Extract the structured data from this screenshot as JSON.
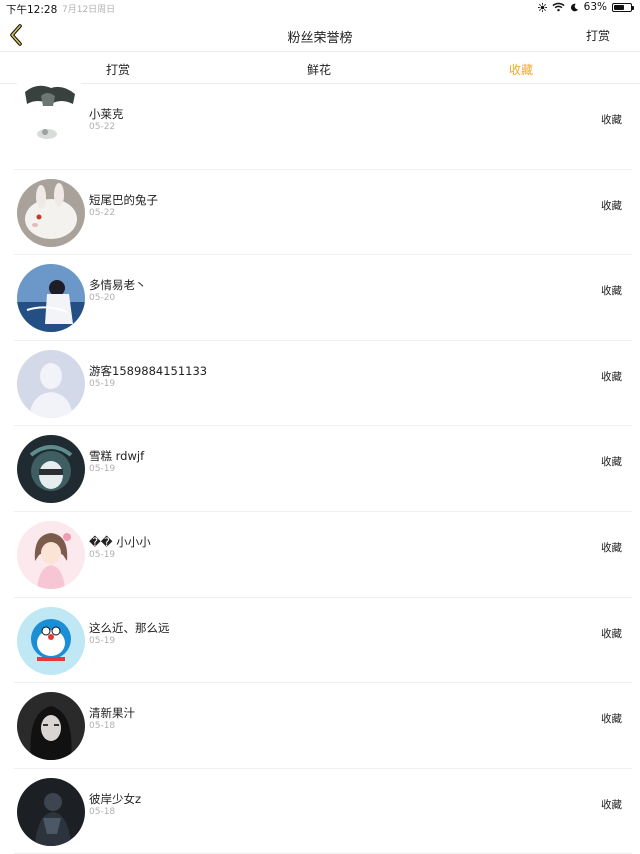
{
  "status_bar": {
    "time": "下午12:28",
    "date": "7月12日周日",
    "battery": "63%",
    "battery_level": 0.63
  },
  "nav": {
    "title": "粉丝荣誉榜",
    "right_action": "打赏"
  },
  "tabs": [
    {
      "label": "打赏",
      "active": false
    },
    {
      "label": "鲜花",
      "active": false
    },
    {
      "label": "收藏",
      "active": true
    }
  ],
  "colors": {
    "accent": "#f0a92a",
    "divider": "#ececec",
    "date_text": "#b0b0b0"
  },
  "fans": [
    {
      "name": "小莱克",
      "date": "05-22",
      "tag": "收藏"
    },
    {
      "name": "短尾巴的兔子",
      "date": "05-22",
      "tag": "收藏"
    },
    {
      "name": "多情易老丶",
      "date": "05-20",
      "tag": "收藏"
    },
    {
      "name": "游客1589884151133",
      "date": "05-19",
      "tag": "收藏"
    },
    {
      "name": "雪糕 rdwjf",
      "date": "05-19",
      "tag": "收藏"
    },
    {
      "name": "�� 小小小",
      "date": "05-19",
      "tag": "收藏"
    },
    {
      "name": "这么近、那么远",
      "date": "05-19",
      "tag": "收藏"
    },
    {
      "name": "清新果汁",
      "date": "05-18",
      "tag": "收藏"
    },
    {
      "name": "彼岸少女z",
      "date": "05-18",
      "tag": "收藏"
    }
  ]
}
